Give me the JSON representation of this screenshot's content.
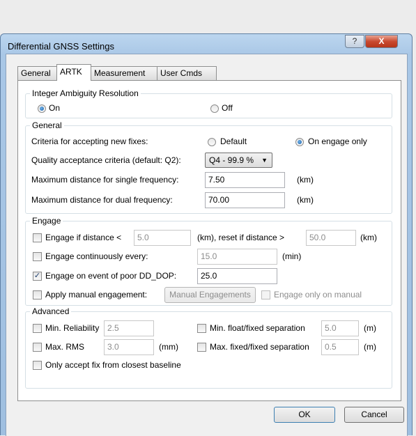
{
  "window": {
    "title": "Differential GNSS Settings",
    "help_glyph": "?",
    "close_glyph": "X"
  },
  "tabs": [
    "General",
    "ARTK",
    "Measurement",
    "User Cmds"
  ],
  "iar": {
    "legend": "Integer Ambiguity Resolution",
    "on_label": "On",
    "off_label": "Off",
    "selected": "On"
  },
  "general": {
    "legend": "General",
    "criteria_label": "Criteria for accepting new fixes:",
    "default_label": "Default",
    "engage_only_label": "On engage only",
    "quality_label": "Quality acceptance criteria (default: Q2):",
    "quality_value": "Q4 - 99.9 %",
    "max_single_label": "Maximum distance for single frequency:",
    "max_single_value": "7.50",
    "max_dual_label": "Maximum distance for dual frequency:",
    "max_dual_value": "70.00",
    "unit_km": "(km)"
  },
  "engage": {
    "legend": "Engage",
    "if_distance_label": "Engage if distance <",
    "if_distance_value": "5.0",
    "reset_label": "(km), reset if distance >",
    "reset_value": "50.0",
    "unit_km": "(km)",
    "continuous_label": "Engage continuously every:",
    "continuous_value": "15.0",
    "unit_min": "(min)",
    "poor_dop_label": "Engage on event of poor DD_DOP:",
    "poor_dop_value": "25.0",
    "apply_manual_label": "Apply manual engagement:",
    "manual_button": "Manual Engagements",
    "only_manual_label": "Engage only on manual"
  },
  "advanced": {
    "legend": "Advanced",
    "min_rel_label": "Min. Reliability",
    "min_rel_value": "2.5",
    "max_rms_label": "Max. RMS",
    "max_rms_value": "3.0",
    "unit_mm": "(mm)",
    "min_sep_label": "Min. float/fixed separation",
    "min_sep_value": "5.0",
    "max_sep_label": "Max. fixed/fixed separation",
    "max_sep_value": "0.5",
    "unit_m": "(m)",
    "closest_label": "Only accept fix from closest baseline"
  },
  "footer": {
    "ok": "OK",
    "cancel": "Cancel"
  }
}
